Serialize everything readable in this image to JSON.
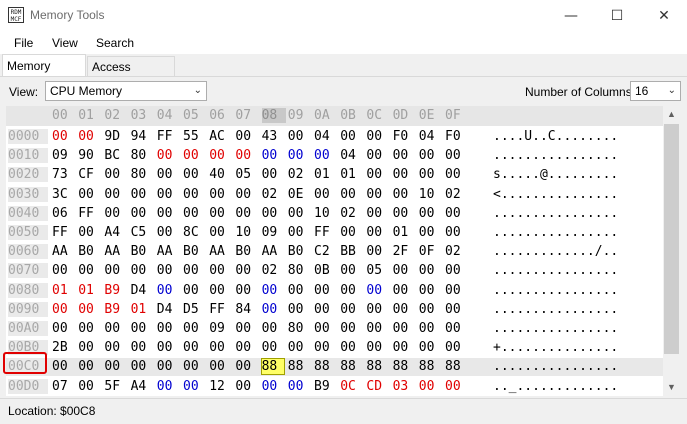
{
  "window": {
    "title": "Memory Tools",
    "icon_text": "RDM\nMCF",
    "controls": [
      "—",
      "☐",
      "✕"
    ]
  },
  "menu": [
    "File",
    "View",
    "Search"
  ],
  "tabs": [
    {
      "label": "Memory Viewer",
      "active": true
    },
    {
      "label": "Access Counters",
      "active": false
    }
  ],
  "toolbar": {
    "view_label": "View:",
    "view_value": "CPU Memory",
    "columns_label": "Number of Columns:",
    "columns_value": "16"
  },
  "hex": {
    "header": [
      "00",
      "01",
      "02",
      "03",
      "04",
      "05",
      "06",
      "07",
      "08",
      "09",
      "0A",
      "0B",
      "0C",
      "0D",
      "0E",
      "0F"
    ],
    "highlight_col": 8,
    "rows": [
      {
        "addr": "0000",
        "bytes": [
          "00",
          "00",
          "9D",
          "94",
          "FF",
          "55",
          "AC",
          "00",
          "43",
          "00",
          "04",
          "00",
          "00",
          "F0",
          "04",
          "F0"
        ],
        "colors": "rr..............",
        "ascii": "....U..C........",
        "acolors": "rr.............."
      },
      {
        "addr": "0010",
        "bytes": [
          "09",
          "90",
          "BC",
          "80",
          "00",
          "00",
          "00",
          "00",
          "00",
          "00",
          "00",
          "04",
          "00",
          "00",
          "00",
          "00"
        ],
        "colors": "....rrrrbbb.....",
        "ascii": "................",
        "acolors": "....rrrrbbb....."
      },
      {
        "addr": "0020",
        "bytes": [
          "73",
          "CF",
          "00",
          "80",
          "00",
          "00",
          "40",
          "05",
          "00",
          "02",
          "01",
          "01",
          "00",
          "00",
          "00",
          "00"
        ],
        "colors": "................",
        "ascii": "s.....@.........",
        "acolors": "................"
      },
      {
        "addr": "0030",
        "bytes": [
          "3C",
          "00",
          "00",
          "00",
          "00",
          "00",
          "00",
          "00",
          "02",
          "0E",
          "00",
          "00",
          "00",
          "00",
          "10",
          "02"
        ],
        "colors": "................",
        "ascii": "<...............",
        "acolors": "................"
      },
      {
        "addr": "0040",
        "bytes": [
          "06",
          "FF",
          "00",
          "00",
          "00",
          "00",
          "00",
          "00",
          "00",
          "00",
          "10",
          "02",
          "00",
          "00",
          "00",
          "00"
        ],
        "colors": "................",
        "ascii": "................",
        "acolors": "................"
      },
      {
        "addr": "0050",
        "bytes": [
          "FF",
          "00",
          "A4",
          "C5",
          "00",
          "8C",
          "00",
          "10",
          "09",
          "00",
          "FF",
          "00",
          "00",
          "01",
          "00",
          "00"
        ],
        "colors": "................",
        "ascii": "................",
        "acolors": "................"
      },
      {
        "addr": "0060",
        "bytes": [
          "AA",
          "B0",
          "AA",
          "B0",
          "AA",
          "B0",
          "AA",
          "B0",
          "AA",
          "B0",
          "C2",
          "BB",
          "00",
          "2F",
          "0F",
          "02"
        ],
        "colors": "................",
        "ascii": "............./..",
        "acolors": "................"
      },
      {
        "addr": "0070",
        "bytes": [
          "00",
          "00",
          "00",
          "00",
          "00",
          "00",
          "00",
          "00",
          "02",
          "80",
          "0B",
          "00",
          "05",
          "00",
          "00",
          "00"
        ],
        "colors": "................",
        "ascii": "................",
        "acolors": "................"
      },
      {
        "addr": "0080",
        "bytes": [
          "01",
          "01",
          "B9",
          "D4",
          "00",
          "00",
          "00",
          "00",
          "00",
          "00",
          "00",
          "00",
          "00",
          "00",
          "00",
          "00"
        ],
        "colors": "rrr.b...b...b...",
        "ascii": "................",
        "acolors": "rrr.b...b...b..."
      },
      {
        "addr": "0090",
        "bytes": [
          "00",
          "00",
          "B9",
          "01",
          "D4",
          "D5",
          "FF",
          "84",
          "00",
          "00",
          "00",
          "00",
          "00",
          "00",
          "00",
          "00"
        ],
        "colors": "rrrr....b.......",
        "ascii": "................",
        "acolors": "rrrr....b......."
      },
      {
        "addr": "00A0",
        "bytes": [
          "00",
          "00",
          "00",
          "00",
          "00",
          "00",
          "09",
          "00",
          "00",
          "80",
          "00",
          "00",
          "00",
          "00",
          "00",
          "00"
        ],
        "colors": "................",
        "ascii": "................",
        "acolors": "................"
      },
      {
        "addr": "00B0",
        "bytes": [
          "2B",
          "00",
          "00",
          "00",
          "00",
          "00",
          "00",
          "00",
          "00",
          "00",
          "00",
          "00",
          "00",
          "00",
          "00",
          "00"
        ],
        "colors": "................",
        "ascii": "+...............",
        "acolors": "................"
      },
      {
        "addr": "00C0",
        "bytes": [
          "00",
          "00",
          "00",
          "00",
          "00",
          "00",
          "00",
          "00",
          "88",
          "88",
          "88",
          "88",
          "88",
          "88",
          "88",
          "88"
        ],
        "colors": "................",
        "ascii": "................",
        "acolors": "................",
        "selected": true,
        "cursor": 8
      },
      {
        "addr": "00D0",
        "bytes": [
          "07",
          "00",
          "5F",
          "A4",
          "00",
          "00",
          "12",
          "00",
          "00",
          "00",
          "B9",
          "0C",
          "CD",
          "03",
          "00",
          "00"
        ],
        "colors": "....bb..bb.rrrrr",
        "ascii": ".._.............",
        "acolors": "....bb..bb.rrrrr"
      }
    ]
  },
  "status": {
    "text": "Location: $00C8"
  }
}
